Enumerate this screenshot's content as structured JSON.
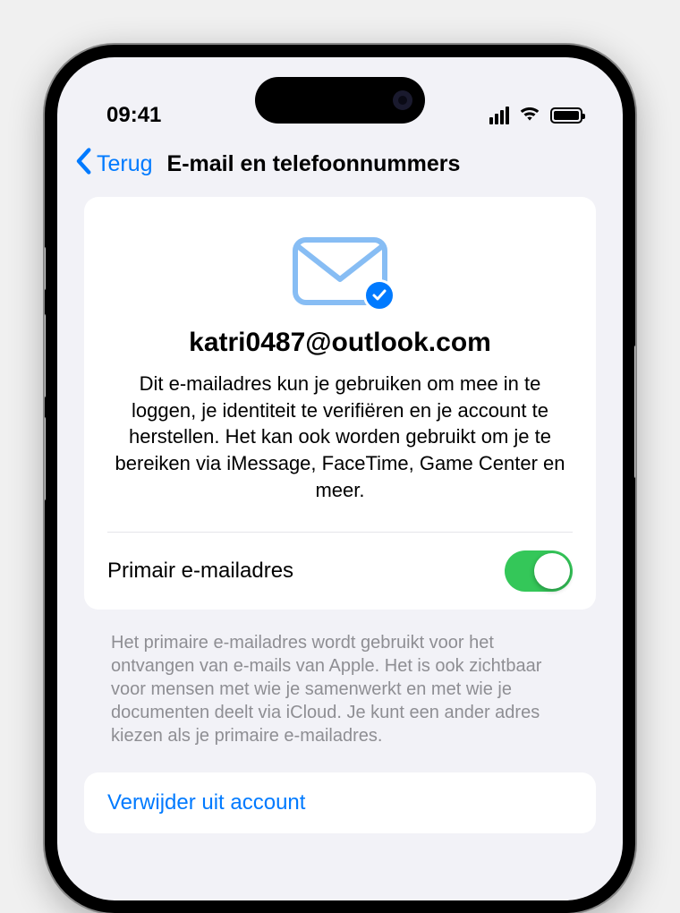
{
  "status_bar": {
    "time": "09:41"
  },
  "nav": {
    "back_label": "Terug",
    "title": "E-mail en telefoonnummers"
  },
  "email_card": {
    "address": "katri0487@outlook.com",
    "description": "Dit e-mailadres kun je gebruiken om mee in te loggen, je identiteit te verifiëren en je account te herstellen. Het kan ook worden gebruikt om je te bereiken via iMessage, FaceTime, Game Center en meer."
  },
  "primary_toggle": {
    "label": "Primair e-mailadres",
    "on": true,
    "footer": "Het primaire e-mailadres wordt gebruikt voor het ontvangen van e-mails van Apple. Het is ook zichtbaar voor mensen met wie je samenwerkt en met wie je documenten deelt via iCloud. Je kunt een ander adres kiezen als je primaire e-mailadres."
  },
  "actions": {
    "remove_label": "Verwijder uit account"
  },
  "colors": {
    "tint": "#007aff",
    "switch_on": "#34c759",
    "background": "#f2f2f7",
    "secondary_text": "#8e8e93"
  }
}
